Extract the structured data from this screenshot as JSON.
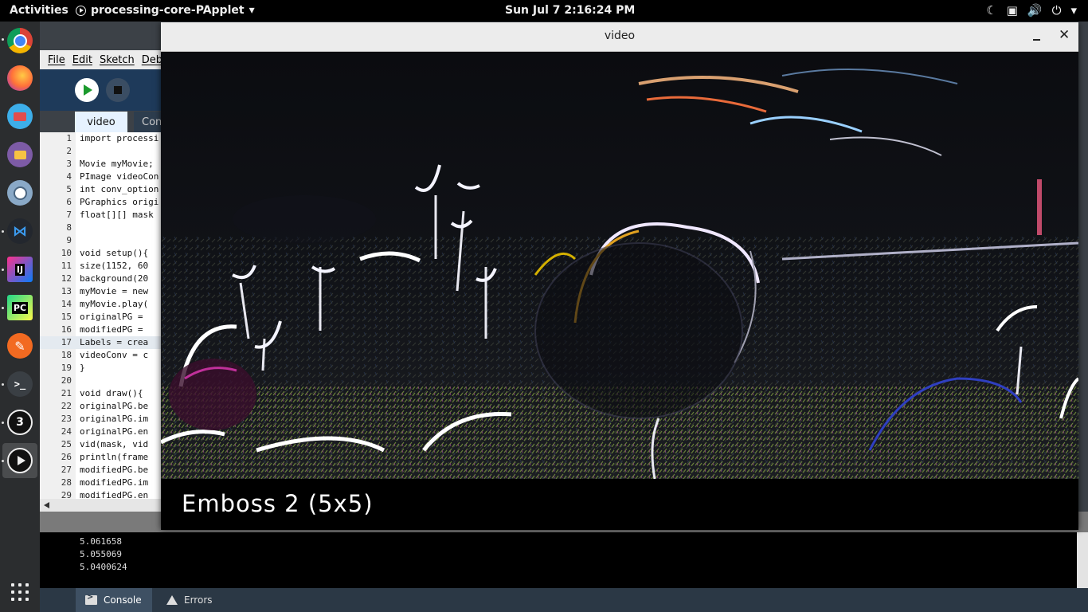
{
  "topbar": {
    "activities": "Activities",
    "app_name": "processing-core-PApplet",
    "clock": "Sun Jul 7   2:16:24 PM"
  },
  "dock": {
    "apps": [
      "chrome-icon",
      "firefox-icon",
      "mail-icon",
      "files-icon",
      "cheese-icon",
      "vscode-icon",
      "intellij-icon",
      "pycharm-icon",
      "gedit-icon",
      "terminal-icon",
      "processing3-icon",
      "processing-run-icon"
    ],
    "intellij_label": "IJ",
    "pycharm_label": "PC",
    "terminal_label": ">_",
    "p3_label": "3"
  },
  "ide": {
    "menu": {
      "file": "File",
      "edit": "Edit",
      "sketch": "Sketch",
      "debug": "Debu"
    },
    "tabs": {
      "active": "video",
      "second": "Con"
    },
    "code_lines": [
      {
        "n": "1",
        "t": "import processi"
      },
      {
        "n": "2",
        "t": ""
      },
      {
        "n": "3",
        "t": "Movie myMovie;"
      },
      {
        "n": "4",
        "t": "PImage videoCon"
      },
      {
        "n": "5",
        "t": "int conv_option"
      },
      {
        "n": "6",
        "t": "PGraphics origi"
      },
      {
        "n": "7",
        "t": "float[][] mask"
      },
      {
        "n": "8",
        "t": ""
      },
      {
        "n": "9",
        "t": ""
      },
      {
        "n": "10",
        "t": "void setup(){"
      },
      {
        "n": "11",
        "t": "  size(1152, 60"
      },
      {
        "n": "12",
        "t": "  background(20"
      },
      {
        "n": "13",
        "t": "  myMovie = new"
      },
      {
        "n": "14",
        "t": "  myMovie.play("
      },
      {
        "n": "15",
        "t": "  originalPG ="
      },
      {
        "n": "16",
        "t": "  modifiedPG ="
      },
      {
        "n": "17",
        "t": "  Labels = crea"
      },
      {
        "n": "18",
        "t": "  videoConv = c"
      },
      {
        "n": "19",
        "t": "}"
      },
      {
        "n": "20",
        "t": ""
      },
      {
        "n": "21",
        "t": "void draw(){"
      },
      {
        "n": "22",
        "t": "  originalPG.be"
      },
      {
        "n": "23",
        "t": "  originalPG.im"
      },
      {
        "n": "24",
        "t": "  originalPG.en"
      },
      {
        "n": "25",
        "t": "  vid(mask, vid"
      },
      {
        "n": "26",
        "t": "  println(frame"
      },
      {
        "n": "27",
        "t": "  modifiedPG.be"
      },
      {
        "n": "28",
        "t": "  modifiedPG.im"
      },
      {
        "n": "29",
        "t": "  modifiedPG.en"
      }
    ],
    "console_lines": [
      "5.061658",
      "5.055069",
      "5.0400624"
    ],
    "footer": {
      "console": "Console",
      "errors": "Errors"
    }
  },
  "video_window": {
    "title": "video",
    "close_glyph": "✕",
    "caption": "Emboss 2 (5x5)"
  }
}
